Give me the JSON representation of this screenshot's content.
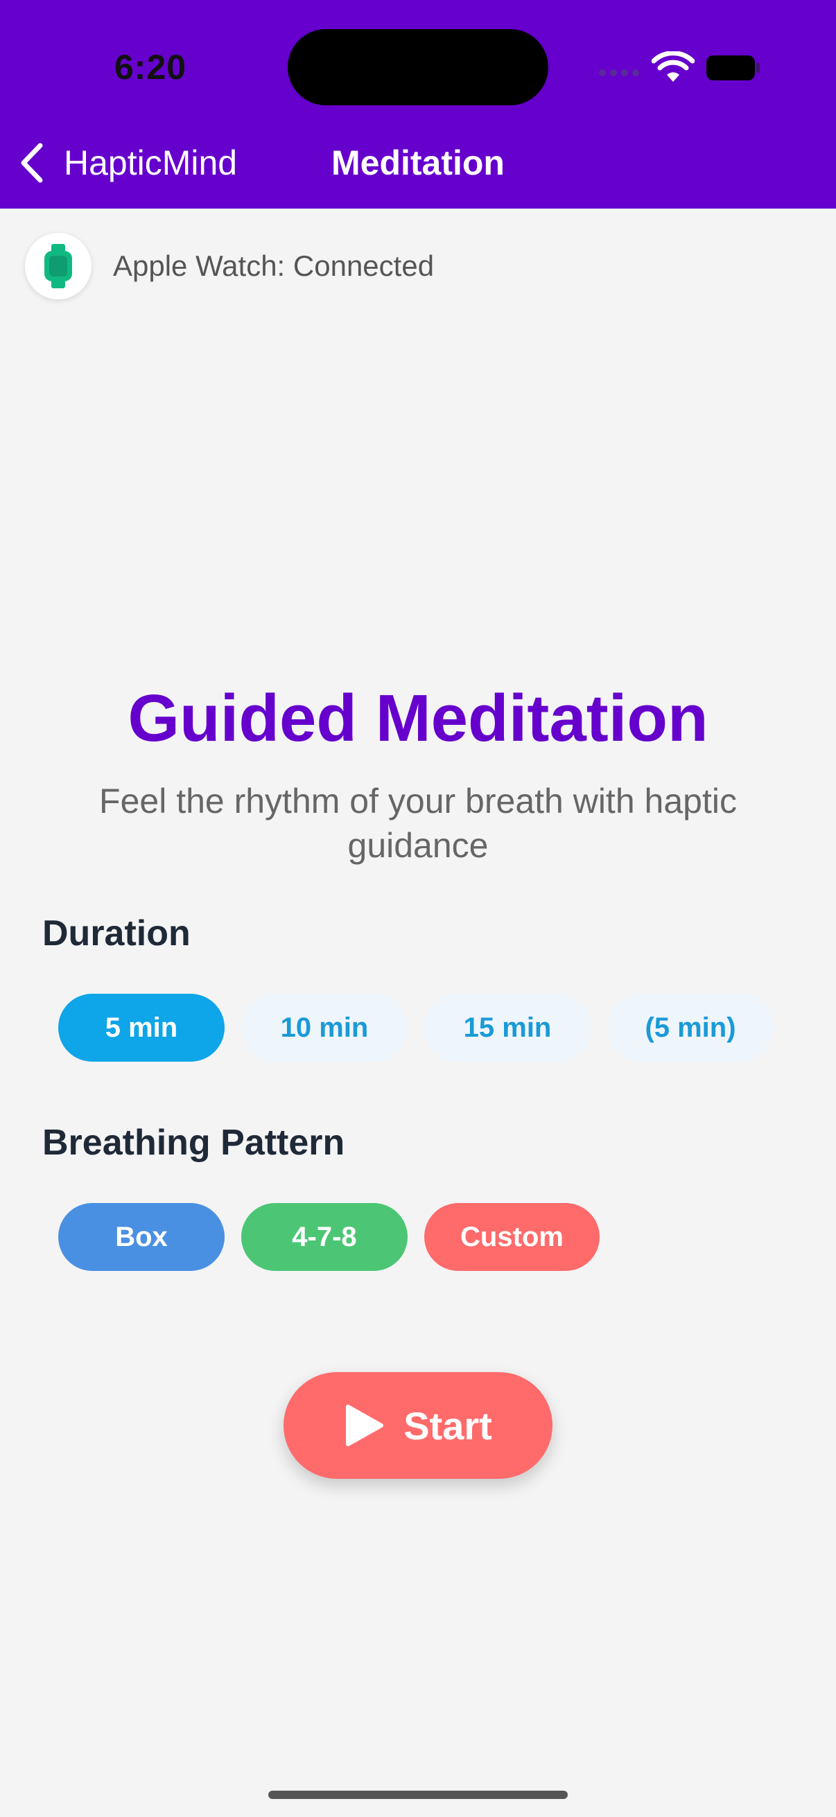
{
  "status_bar": {
    "time": "6:20"
  },
  "nav": {
    "back_label": "HapticMind",
    "title": "Meditation"
  },
  "watch": {
    "status": "Apple Watch: Connected",
    "icon": "watch-icon",
    "color": "#10b981"
  },
  "hero": {
    "title": "Guided Meditation",
    "subtitle": "Feel the rhythm of your breath with haptic guidance"
  },
  "duration": {
    "label": "Duration",
    "options": [
      "5 min",
      "10 min",
      "15 min",
      "(5 min)"
    ],
    "selected": "5 min"
  },
  "pattern": {
    "label": "Breathing Pattern",
    "options": [
      {
        "label": "Box",
        "color": "#4a90e2"
      },
      {
        "label": "4-7-8",
        "color": "#4cc674"
      },
      {
        "label": "Custom",
        "color": "#ff6b6b"
      }
    ]
  },
  "start": {
    "label": "Start",
    "icon": "play-icon"
  },
  "colors": {
    "header": "#6600cc",
    "accent": "#0ea5e9",
    "start": "#ff6b6b"
  }
}
